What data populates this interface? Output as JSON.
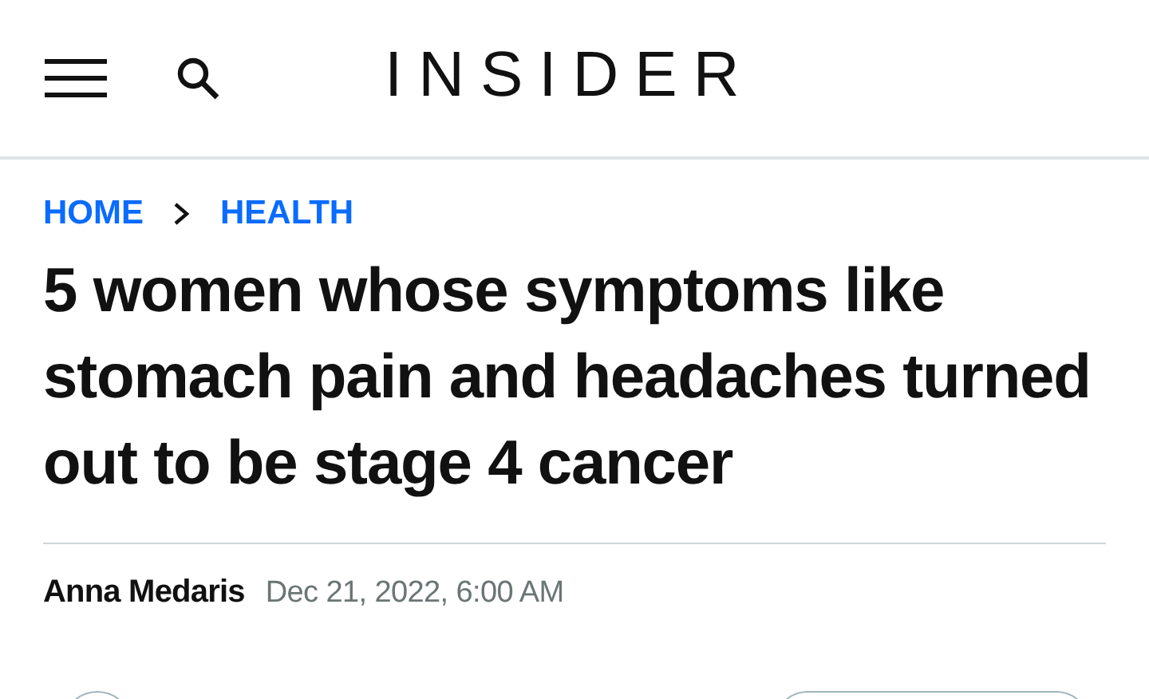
{
  "header": {
    "logo": "INSIDER"
  },
  "breadcrumbs": [
    {
      "label": "HOME"
    },
    {
      "label": "HEALTH"
    }
  ],
  "headline": "5 women whose symptoms like stomach pain and headaches turned out to be stage 4 cancer",
  "byline": {
    "author": "Anna Medaris",
    "date": "Dec 21, 2022, 6:00 AM"
  }
}
